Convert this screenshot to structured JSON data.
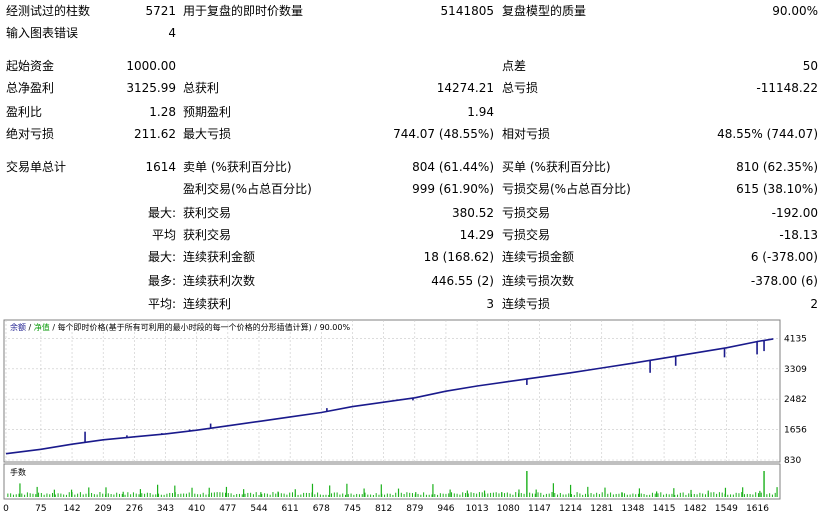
{
  "stats": {
    "bars_tested_label": "经测试过的柱数",
    "bars_tested": "5721",
    "ticks_label": "用于复盘的即时价数量",
    "ticks": "5141805",
    "quality_label": "复盘模型的质量",
    "quality": "90.00%",
    "errors_label": "输入图表错误",
    "errors": "4",
    "deposit_label": "起始资金",
    "deposit": "1000.00",
    "spread_label": "点差",
    "spread": "50",
    "net_profit_label": "总净盈利",
    "net_profit": "3125.99",
    "gross_profit_label": "总获利",
    "gross_profit": "14274.21",
    "gross_loss_label": "总亏损",
    "gross_loss": "-11148.22",
    "profit_factor_label": "盈利比",
    "profit_factor": "1.28",
    "expected_payoff_label": "预期盈利",
    "expected_payoff": "1.94",
    "abs_dd_label": "绝对亏损",
    "abs_dd": "211.62",
    "max_dd_label": "最大亏损",
    "max_dd": "744.07 (48.55%)",
    "rel_dd_label": "相对亏损",
    "rel_dd": "48.55% (744.07)",
    "total_trades_label": "交易单总计",
    "total_trades": "1614",
    "short_label": "卖单 (%获利百分比)",
    "short": "804 (61.44%)",
    "long_label": "买单 (%获利百分比)",
    "long": "810 (62.35%)",
    "profit_trades_label": "盈利交易(%占总百分比)",
    "profit_trades": "999 (61.90%)",
    "loss_trades_label": "亏损交易(%占总百分比)",
    "loss_trades": "615 (38.10%)",
    "largest_label": "最大:",
    "largest_profit_label": "获利交易",
    "largest_profit": "380.52",
    "largest_loss_label": "亏损交易",
    "largest_loss": "-192.00",
    "average_label": "平均",
    "avg_profit_label": "获利交易",
    "avg_profit": "14.29",
    "avg_loss_label": "亏损交易",
    "avg_loss": "-18.13",
    "max_consec_label": "最大:",
    "max_consec_wins_label": "连续获利金额",
    "max_consec_wins": "18 (168.62)",
    "max_consec_losses_label": "连续亏损金额",
    "max_consec_losses": "6 (-378.00)",
    "maximal_label": "最多:",
    "maximal_wins_label": "连续获利次数",
    "maximal_wins": "446.55 (2)",
    "maximal_losses_label": "连续亏损次数",
    "maximal_losses": "-378.00 (6)",
    "avg_consec_label": "平均:",
    "avg_consec_wins_label": "连续获利",
    "avg_consec_wins": "3",
    "avg_consec_losses_label": "连续亏损",
    "avg_consec_losses": "2"
  },
  "chart": {
    "legend_balance": "余额",
    "legend_sep1": " / ",
    "legend_equity": "净值",
    "legend_rest": " / 每个即时价格(基于所有可利用的最小时段的每一个价格的分形插值计算) / 90.00%",
    "volume_label": "手数",
    "colors": {
      "balance": "#1a1a8c",
      "equity": "#0a9a0a",
      "volume": "#1ab01a",
      "grid": "#c8c8c8"
    }
  },
  "chart_data": {
    "type": "line",
    "series": [
      {
        "name": "余额",
        "x": [
          0,
          75,
          142,
          209,
          276,
          343,
          410,
          477,
          544,
          611,
          678,
          745,
          812,
          879,
          946,
          1013,
          1080,
          1147,
          1214,
          1281,
          1348,
          1415,
          1482,
          1549,
          1616,
          1650
        ],
        "values": [
          1000,
          1120,
          1260,
          1380,
          1460,
          1540,
          1640,
          1760,
          1880,
          2000,
          2120,
          2280,
          2400,
          2520,
          2700,
          2840,
          2960,
          3080,
          3200,
          3330,
          3460,
          3600,
          3740,
          3880,
          4050,
          4120
        ]
      }
    ],
    "dips": [
      {
        "x": 170,
        "to": 1600
      },
      {
        "x": 260,
        "to": 1500
      },
      {
        "x": 335,
        "to": 1560
      },
      {
        "x": 395,
        "to": 1660
      },
      {
        "x": 440,
        "to": 1820
      },
      {
        "x": 690,
        "to": 2240
      },
      {
        "x": 875,
        "to": 2450
      },
      {
        "x": 1120,
        "to": 2870
      },
      {
        "x": 1385,
        "to": 3200
      },
      {
        "x": 1440,
        "to": 3390
      },
      {
        "x": 1545,
        "to": 3620
      },
      {
        "x": 1615,
        "to": 3700
      },
      {
        "x": 1630,
        "to": 3790
      }
    ],
    "volume_markers": [
      {
        "x": 1120,
        "h": 1.0
      },
      {
        "x": 1630,
        "h": 1.0
      }
    ],
    "x_ticks": [
      0,
      75,
      142,
      209,
      276,
      343,
      410,
      477,
      544,
      611,
      678,
      745,
      812,
      879,
      946,
      1013,
      1080,
      1147,
      1214,
      1281,
      1348,
      1415,
      1482,
      1549,
      1616
    ],
    "y_ticks": [
      830,
      1656,
      2482,
      3309,
      4135
    ],
    "xlim": [
      0,
      1660
    ],
    "ylim": [
      830,
      4200
    ]
  }
}
